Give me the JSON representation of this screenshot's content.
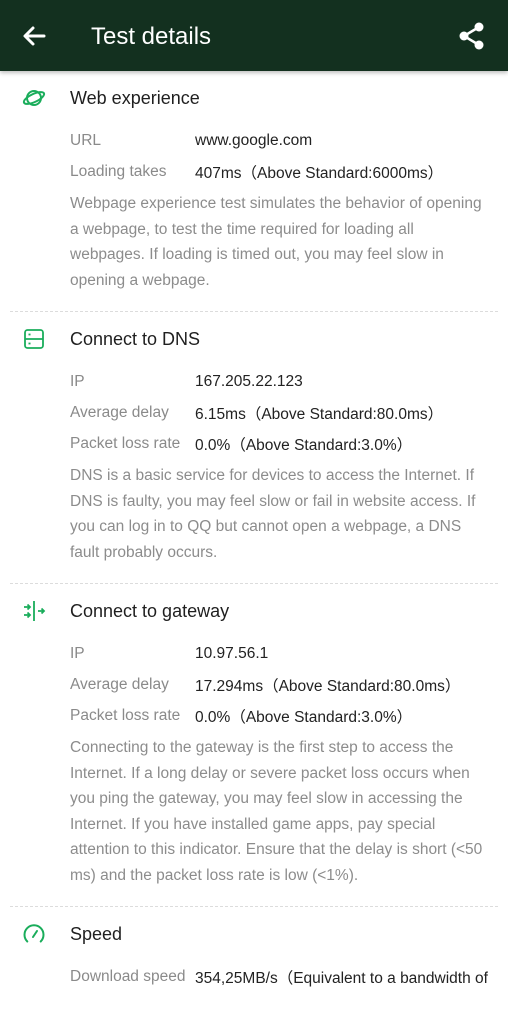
{
  "header": {
    "title": "Test details",
    "back_icon": "arrow-left-icon",
    "share_icon": "share-icon"
  },
  "colors": {
    "appbar": "#13301f",
    "accent": "#1aad5b"
  },
  "sections": [
    {
      "icon": "planet-icon",
      "title": "Web experience",
      "rows": [
        {
          "label": "URL",
          "value": "www.google.com"
        },
        {
          "label": "Loading takes",
          "value": "407ms（Above Standard:6000ms）"
        }
      ],
      "description": "Webpage experience test simulates the behavior of opening a webpage, to test the time required for loading all webpages. If loading is timed out, you may feel slow in opening a webpage."
    },
    {
      "icon": "server-icon",
      "title": "Connect to DNS",
      "rows": [
        {
          "label": "IP",
          "value": "167.205.22.123"
        },
        {
          "label": "Average delay",
          "value": "6.15ms（Above Standard:80.0ms）"
        },
        {
          "label": "Packet loss rate",
          "value": "0.0%（Above Standard:3.0%）"
        }
      ],
      "description": "DNS is a basic service for devices to access the Internet. If DNS is faulty, you may feel slow or fail in website access. If you can log in to QQ but cannot open a webpage, a DNS fault probably occurs."
    },
    {
      "icon": "gateway-icon",
      "title": "Connect to gateway",
      "rows": [
        {
          "label": "IP",
          "value": "10.97.56.1"
        },
        {
          "label": "Average delay",
          "value": "17.294ms（Above Standard:80.0ms）"
        },
        {
          "label": "Packet loss rate",
          "value": "0.0%（Above Standard:3.0%）"
        }
      ],
      "description": "Connecting to the gateway is the first step to access the Internet. If a long delay or severe packet loss occurs when you ping the gateway, you may feel slow in accessing the Internet. If you have installed game apps, pay special attention to this indicator. Ensure that the delay is short (<50 ms) and the packet loss rate is low (<1%)."
    },
    {
      "icon": "speedometer-icon",
      "title": "Speed",
      "rows": [
        {
          "label": "Download speed",
          "value": "354,25MB/s（Equivalent to a bandwidth of"
        }
      ]
    }
  ]
}
